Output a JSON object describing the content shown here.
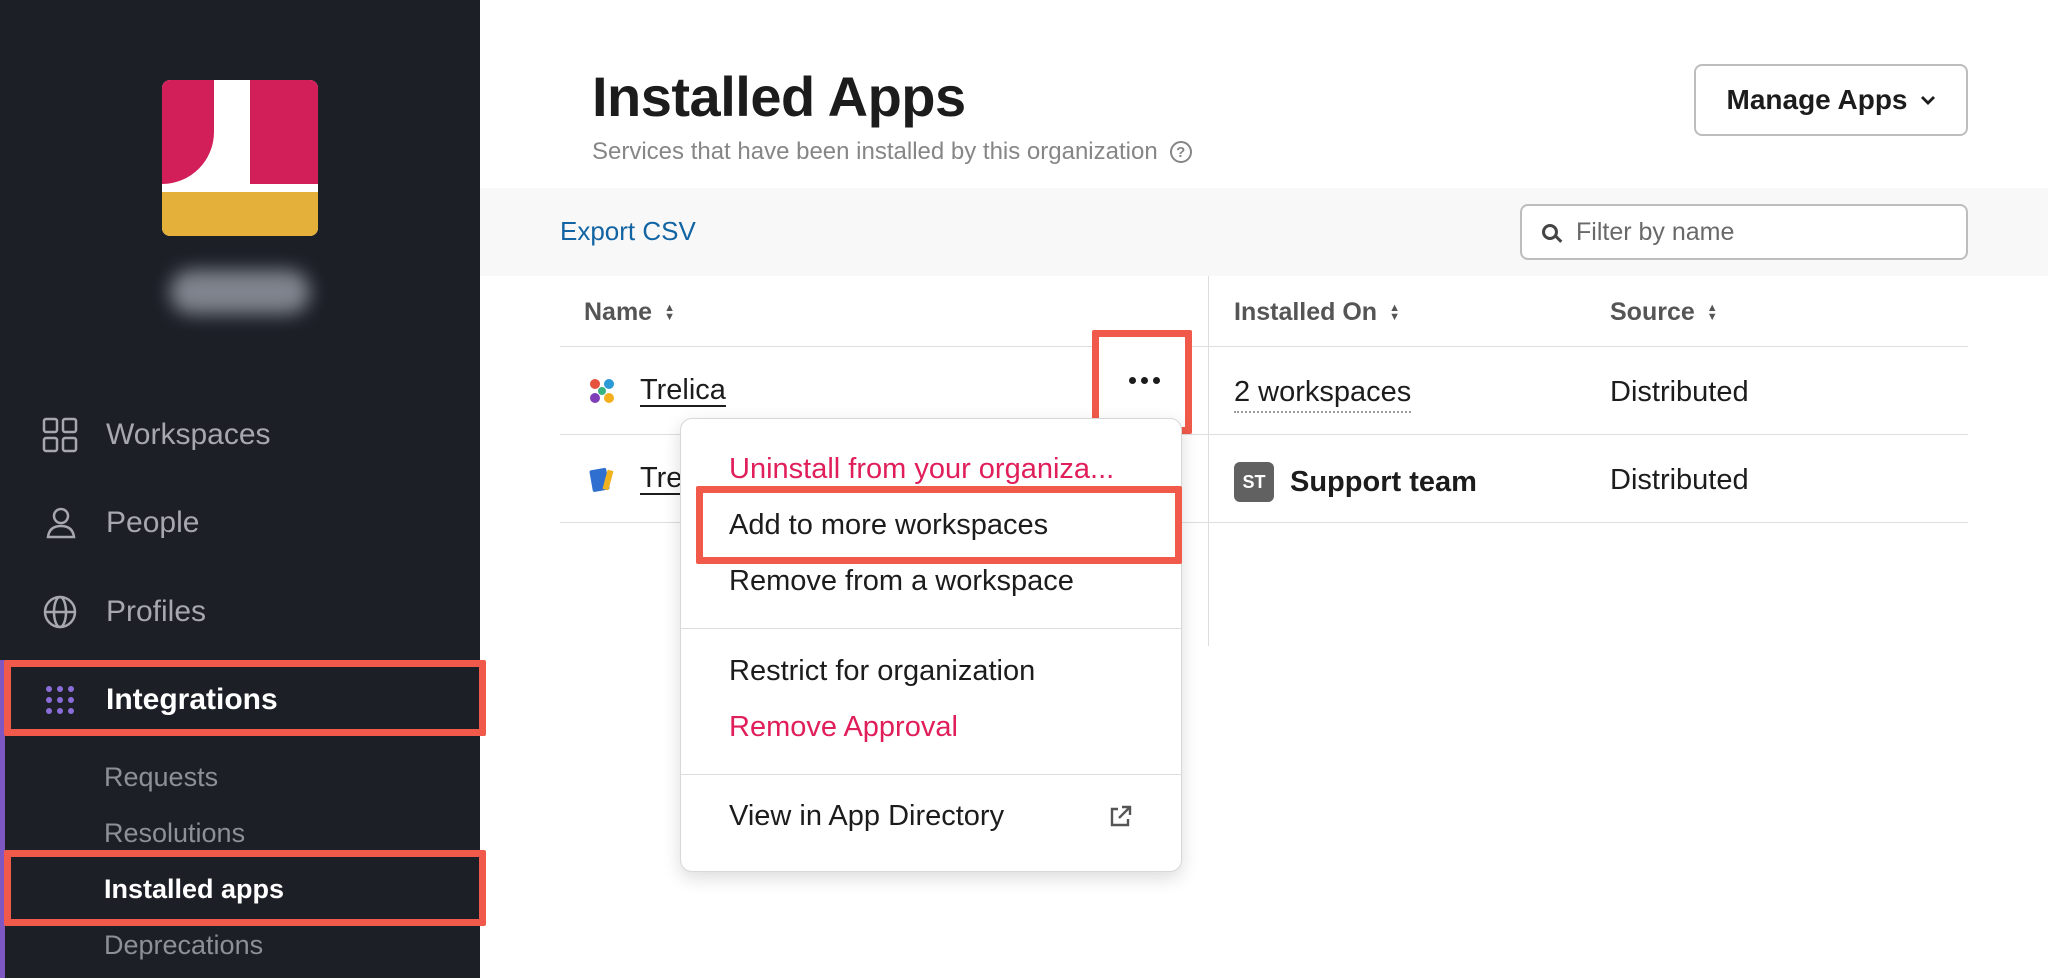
{
  "sidebar": {
    "nav": [
      {
        "label": "Workspaces",
        "icon": "grid-icon"
      },
      {
        "label": "People",
        "icon": "person-icon"
      },
      {
        "label": "Profiles",
        "icon": "globe-icon"
      },
      {
        "label": "Integrations",
        "icon": "dots-grid-icon"
      }
    ],
    "sub": [
      "Requests",
      "Resolutions",
      "Installed apps",
      "Deprecations"
    ]
  },
  "header": {
    "title": "Installed Apps",
    "subtitle": "Services that have been installed by this organization",
    "manage_label": "Manage Apps"
  },
  "toolbar": {
    "export_label": "Export CSV",
    "filter_placeholder": "Filter by name"
  },
  "table": {
    "columns": [
      "Name",
      "Installed On",
      "Source"
    ],
    "rows": [
      {
        "name": "Trelica",
        "installed_on": "2 workspaces",
        "source": "Distributed"
      },
      {
        "name": "Tre",
        "installed_on": "Support team",
        "badge": "ST",
        "source": "Distributed"
      }
    ]
  },
  "menu": {
    "items": [
      "Uninstall from your organiza...",
      "Add to more workspaces",
      "Remove from a workspace",
      "Restrict for organization",
      "Remove Approval",
      "View in App Directory"
    ]
  },
  "colors": {
    "sidebar_bg": "#1c1f26",
    "highlight": "#f15a4a",
    "danger": "#e01e5a",
    "link": "#1264a3"
  }
}
